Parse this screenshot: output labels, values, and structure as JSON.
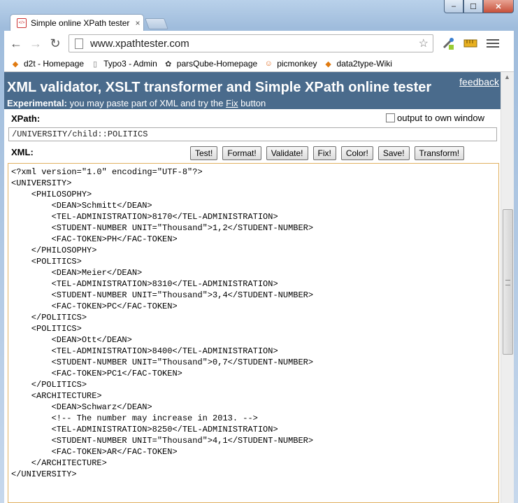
{
  "window": {
    "minimize_label": "–",
    "maximize_label": "☐",
    "close_label": "✕"
  },
  "tab": {
    "title": "Simple online XPath tester",
    "close_label": "×",
    "favicon": "</>"
  },
  "toolbar": {
    "back_label": "←",
    "forward_label": "→",
    "reload_label": "↻",
    "url": "www.xpathtester.com",
    "star_label": "☆"
  },
  "bookmarks": [
    {
      "label": "d2t - Homepage",
      "icon": "d2t-icon",
      "glyph": "◆"
    },
    {
      "label": "Typo3 - Admin",
      "icon": "page-icon",
      "glyph": "▯"
    },
    {
      "label": "parsQube-Homepage",
      "icon": "parsqube-icon",
      "glyph": "✿"
    },
    {
      "label": "picmonkey",
      "icon": "picmonkey-icon",
      "glyph": "☺"
    },
    {
      "label": "data2type-Wiki",
      "icon": "d2t-icon",
      "glyph": "◆"
    }
  ],
  "banner": {
    "title": "XML validator, XSLT transformer and Simple XPath online tester",
    "feedback": "feedback",
    "sub_bold": "Experimental:",
    "sub_text": " you may paste part of XML and try the ",
    "sub_link": "Fix",
    "sub_tail": " button"
  },
  "xpath": {
    "label": "XPath:",
    "value": "/UNIVERSITY/child::POLITICS",
    "own_window_label": "output to own window"
  },
  "xml": {
    "label": "XML:",
    "buttons": [
      "Test!",
      "Format!",
      "Validate!",
      "Fix!",
      "Color!",
      "Save!",
      "Transform!"
    ],
    "lines": [
      "<?xml version=\"1.0\" encoding=\"UTF-8\"?>",
      "<UNIVERSITY>",
      "    <PHILOSOPHY>",
      "        <DEAN>Schmitt</DEAN>",
      "        <TEL-ADMINISTRATION>8170</TEL-ADMINISTRATION>",
      "        <STUDENT-NUMBER UNIT=\"Thousand\">1,2</STUDENT-NUMBER>",
      "        <FAC-TOKEN>PH</FAC-TOKEN>",
      "    </PHILOSOPHY>",
      "    <POLITICS>",
      "        <DEAN>Meier</DEAN>",
      "        <TEL-ADMINISTRATION>8310</TEL-ADMINISTRATION>",
      "        <STUDENT-NUMBER UNIT=\"Thousand\">3,4</STUDENT-NUMBER>",
      "        <FAC-TOKEN>PC</FAC-TOKEN>",
      "    </POLITICS>",
      "    <POLITICS>",
      "        <DEAN>Ott</DEAN>",
      "        <TEL-ADMINISTRATION>8400</TEL-ADMINISTRATION>",
      "        <STUDENT-NUMBER UNIT=\"Thousand\">0,7</STUDENT-NUMBER>",
      "        <FAC-TOKEN>PC1</FAC-TOKEN>",
      "    </POLITICS>",
      "    <ARCHITECTURE>",
      "        <DEAN>Schwarz</DEAN>",
      "        <!-- The number may increase in 2013. -->",
      "        <TEL-ADMINISTRATION>8250</TEL-ADMINISTRATION>",
      "        <STUDENT-NUMBER UNIT=\"Thousand\">4,1</STUDENT-NUMBER>",
      "        <FAC-TOKEN>AR</FAC-TOKEN>",
      "    </ARCHITECTURE>",
      "</UNIVERSITY>"
    ]
  }
}
